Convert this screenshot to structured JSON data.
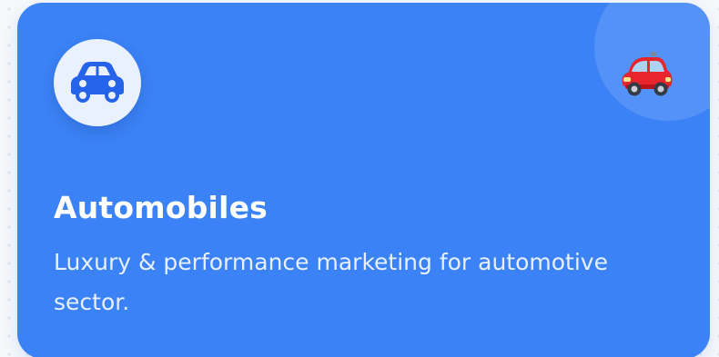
{
  "card": {
    "title": "Automobiles",
    "description": "Luxury & performance marketing for automotive sector.",
    "accent_color": "#3b82f6",
    "icon": "car-icon",
    "decoration_icon": "red-car-emoji-icon"
  }
}
